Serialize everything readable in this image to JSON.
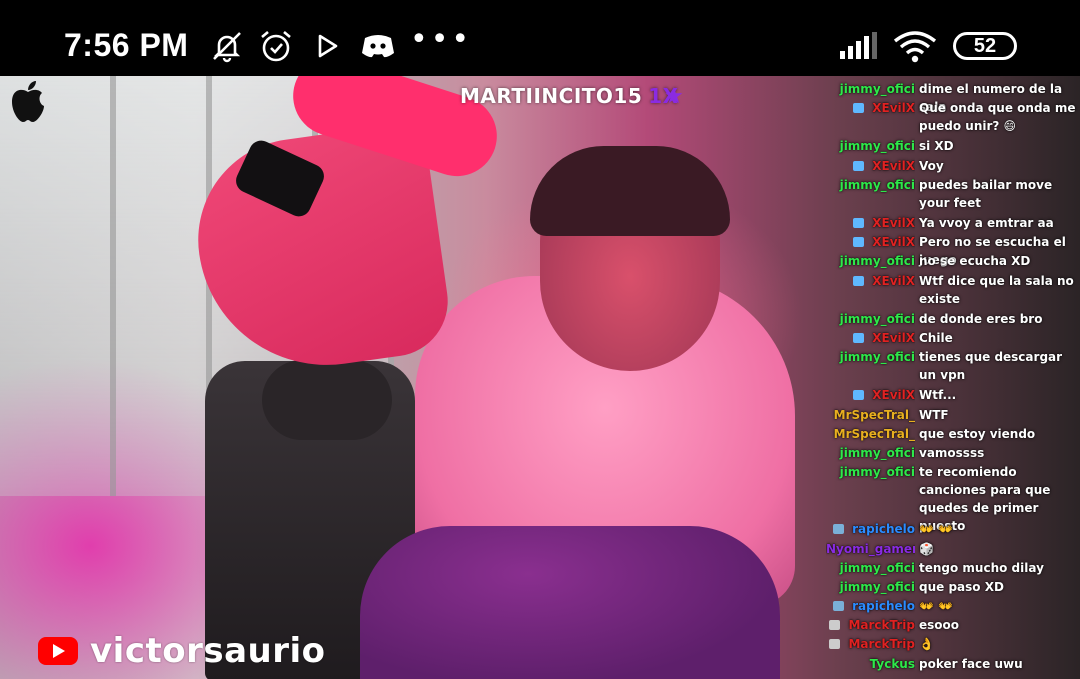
{
  "status_bar": {
    "time": "7:56 PM",
    "icons": [
      "mute-bell-icon",
      "alarm-icon",
      "play-store-icon",
      "discord-icon",
      "more-dots-icon",
      "signal-icon",
      "wifi-icon"
    ],
    "more": "•••",
    "battery": "52"
  },
  "overlay": {
    "streamer": "MARTIINCITO15",
    "multiplier": "1X",
    "star": "★",
    "channel": "victorsaurio"
  },
  "colors": {
    "green": "#2ee84a",
    "red": "#e02222",
    "gold": "#e8b020",
    "blue": "#2b8cff",
    "purple": "#8a2be2",
    "yt_red": "#ff0000"
  },
  "chat": [
    {
      "user": "jimmy_ofici",
      "color": "#2ee84a",
      "badge": "",
      "text": "dime el numero de la sala"
    },
    {
      "user": "XEvilX",
      "color": "#e02222",
      "badge": "#5fb8ff",
      "text": "Que onda que onda me puedo unir? 😄"
    },
    {
      "user": "jimmy_ofici",
      "color": "#2ee84a",
      "badge": "",
      "text": "si XD"
    },
    {
      "user": "XEvilX",
      "color": "#e02222",
      "badge": "#5fb8ff",
      "text": "Voy"
    },
    {
      "user": "jimmy_ofici",
      "color": "#2ee84a",
      "badge": "",
      "text": "puedes bailar move your feet"
    },
    {
      "user": "XEvilX",
      "color": "#e02222",
      "badge": "#5fb8ff",
      "text": "Ya vvoy a emtrar aa"
    },
    {
      "user": "XEvilX",
      "color": "#e02222",
      "badge": "#5fb8ff",
      "text": "Pero no se escucha el juego"
    },
    {
      "user": "jimmy_ofici",
      "color": "#2ee84a",
      "badge": "",
      "text": "no se ecucha XD"
    },
    {
      "user": "XEvilX",
      "color": "#e02222",
      "badge": "#5fb8ff",
      "text": "Wtf dice que la sala no existe"
    },
    {
      "user": "jimmy_ofici",
      "color": "#2ee84a",
      "badge": "",
      "text": "de donde eres bro"
    },
    {
      "user": "XEvilX",
      "color": "#e02222",
      "badge": "#5fb8ff",
      "text": "Chile"
    },
    {
      "user": "jimmy_ofici",
      "color": "#2ee84a",
      "badge": "",
      "text": "tienes que descargar un vpn"
    },
    {
      "user": "XEvilX",
      "color": "#e02222",
      "badge": "#5fb8ff",
      "text": "Wtf..."
    },
    {
      "user": "MrSpecTral_",
      "color": "#e8b020",
      "badge": "",
      "text": "WTF"
    },
    {
      "user": "MrSpecTral_",
      "color": "#e8b020",
      "badge": "",
      "text": "que estoy viendo"
    },
    {
      "user": "jimmy_ofici",
      "color": "#2ee84a",
      "badge": "",
      "text": "vamossss"
    },
    {
      "user": "jimmy_ofici",
      "color": "#2ee84a",
      "badge": "",
      "text": "te recomiendo canciones para que quedes de primer puesto"
    },
    {
      "user": "rapichelo",
      "color": "#2b8cff",
      "badge": "#7ab0d8",
      "text": "👐 👐"
    },
    {
      "user": "Nyomi_gamer",
      "color": "#8a2be2",
      "badge": "",
      "text": "🎲"
    },
    {
      "user": "jimmy_ofici",
      "color": "#2ee84a",
      "badge": "",
      "text": "tengo mucho dilay"
    },
    {
      "user": "jimmy_ofici",
      "color": "#2ee84a",
      "badge": "",
      "text": "que paso XD"
    },
    {
      "user": "rapichelo",
      "color": "#2b8cff",
      "badge": "#7ab0d8",
      "text": "👐 👐"
    },
    {
      "user": "MarckTrip",
      "color": "#e02222",
      "badge": "#cccccc",
      "text": "esooo"
    },
    {
      "user": "MarckTrip",
      "color": "#e02222",
      "badge": "#cccccc",
      "text": "👌"
    },
    {
      "user": "Tyckus",
      "color": "#2ee84a",
      "badge": "",
      "text": "poker face uwu"
    }
  ]
}
